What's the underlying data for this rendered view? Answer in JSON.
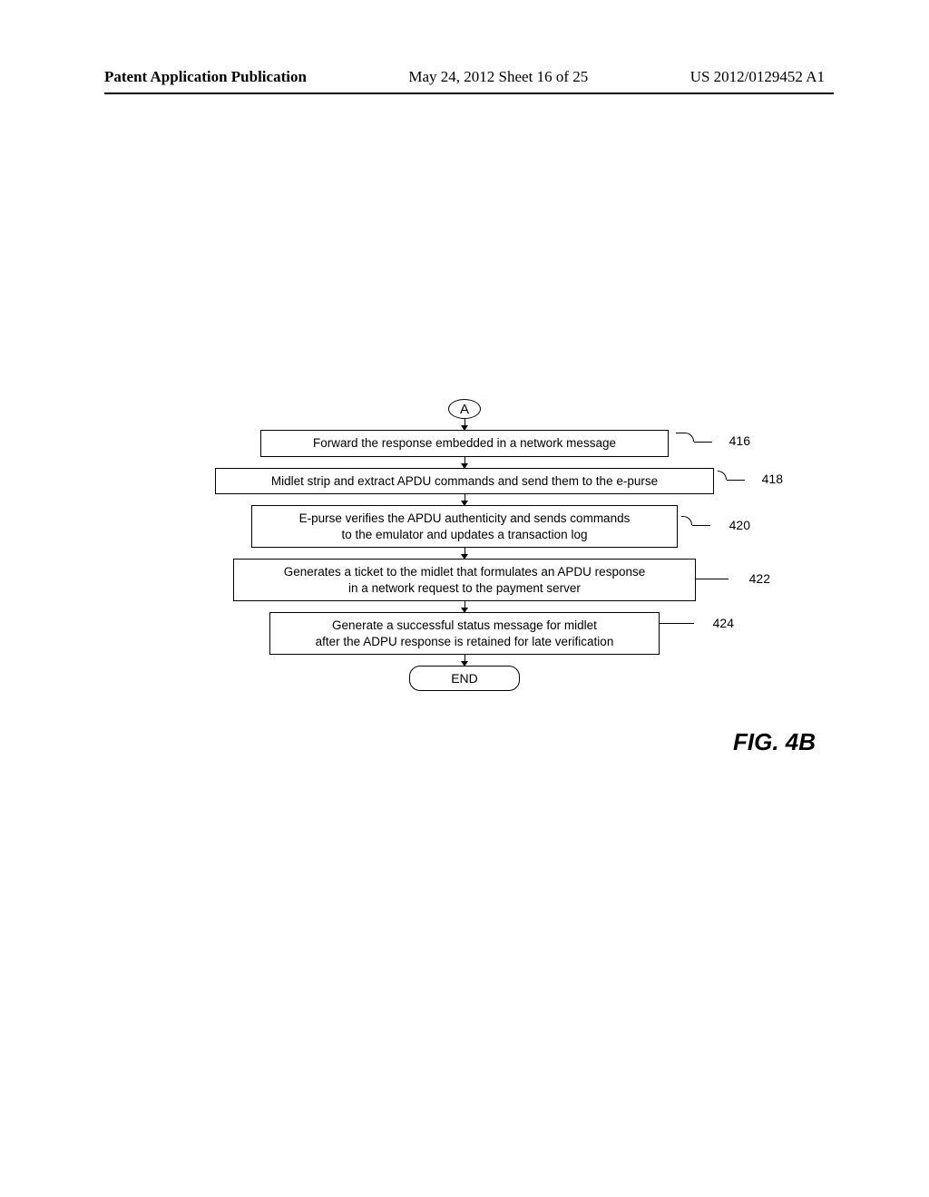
{
  "header": {
    "left": "Patent Application Publication",
    "center": "May 24, 2012  Sheet 16 of 25",
    "right": "US 2012/0129452 A1"
  },
  "connector": "A",
  "steps": [
    {
      "text": "Forward the response embedded in a network message",
      "label": "416"
    },
    {
      "text": "Midlet strip and extract APDU commands and send them to the e-purse",
      "label": "418"
    },
    {
      "text_line1": "E-purse verifies the APDU authenticity and sends commands",
      "text_line2": "to the emulator and updates a transaction log",
      "label": "420"
    },
    {
      "text_line1": "Generates a ticket to the midlet that formulates an APDU response",
      "text_line2": "in a network request to the payment server",
      "label": "422"
    },
    {
      "text_line1": "Generate a successful status message for midlet",
      "text_line2": "after the ADPU response is retained for late verification",
      "label": "424"
    }
  ],
  "terminal": "END",
  "figure_label": "FIG. 4B"
}
